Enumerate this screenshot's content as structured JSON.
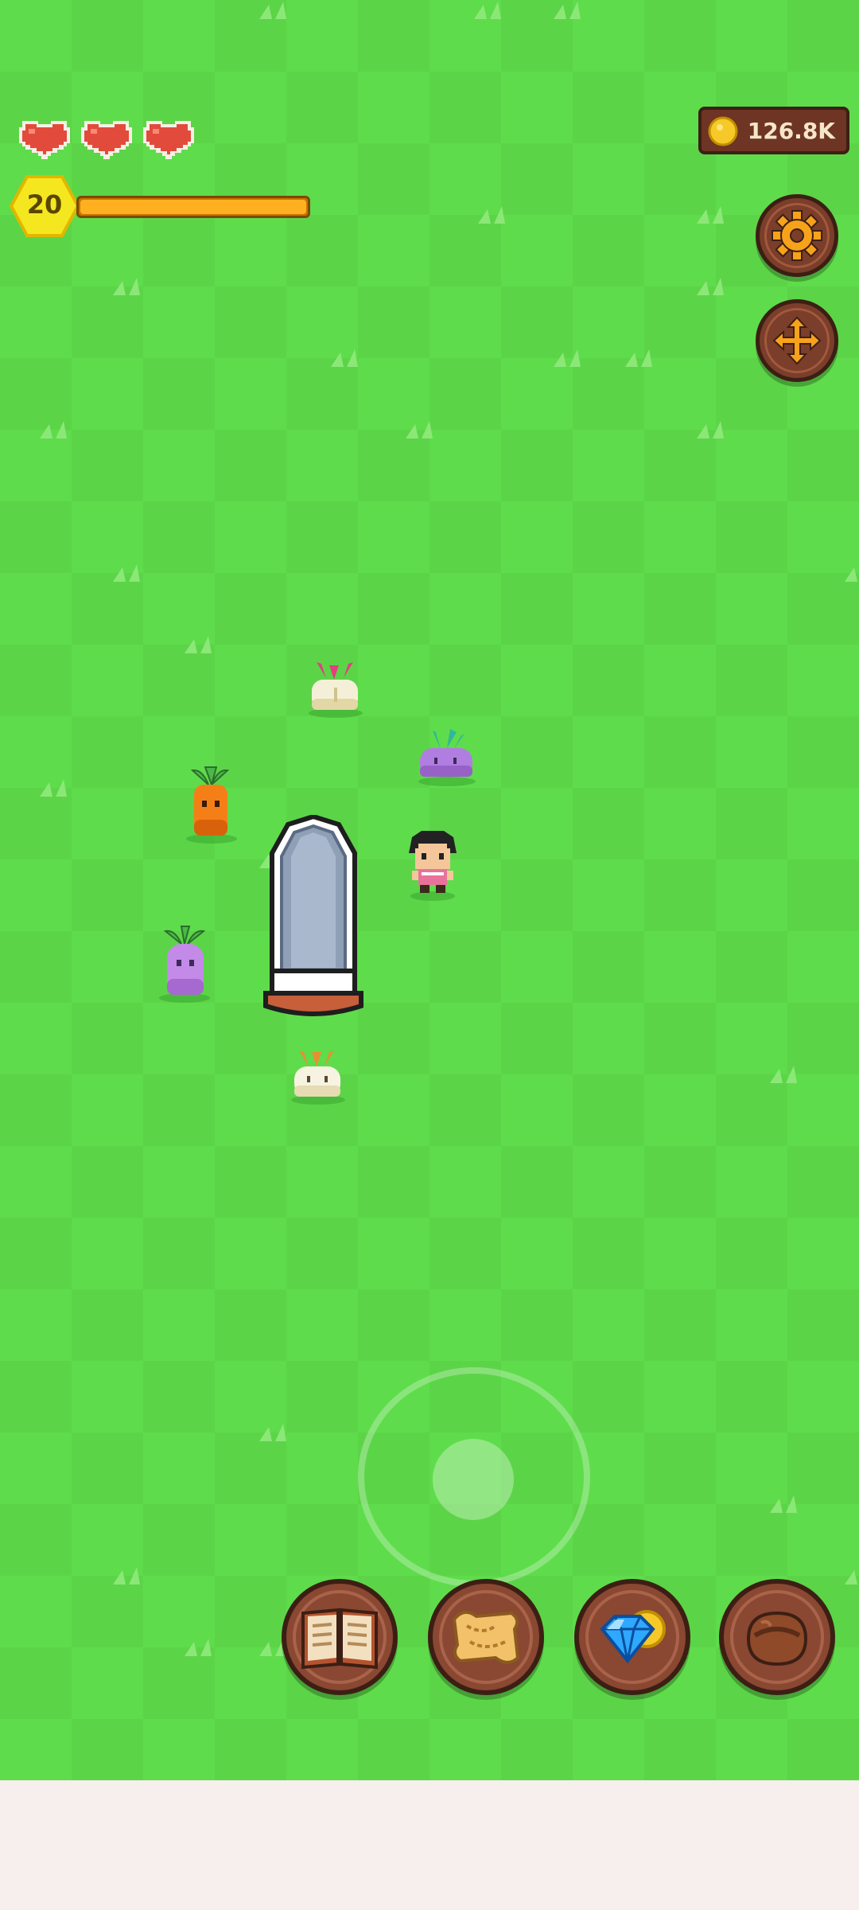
{
  "hud": {
    "hearts": 3,
    "level": "20",
    "xp_progress": 1.0,
    "coins": "126.8K"
  },
  "icons": {
    "settings": "gear-icon",
    "move": "move-arrows-icon",
    "dock": [
      "spellbook-icon",
      "scroll-map-icon",
      "gem-and-coin-icon",
      "leather-bag-icon"
    ]
  },
  "colors": {
    "grass": "#5fdc4b",
    "heart": "#e24b3b",
    "xp_bar": "#ffb020",
    "button_wood": "#7a3e2a"
  }
}
